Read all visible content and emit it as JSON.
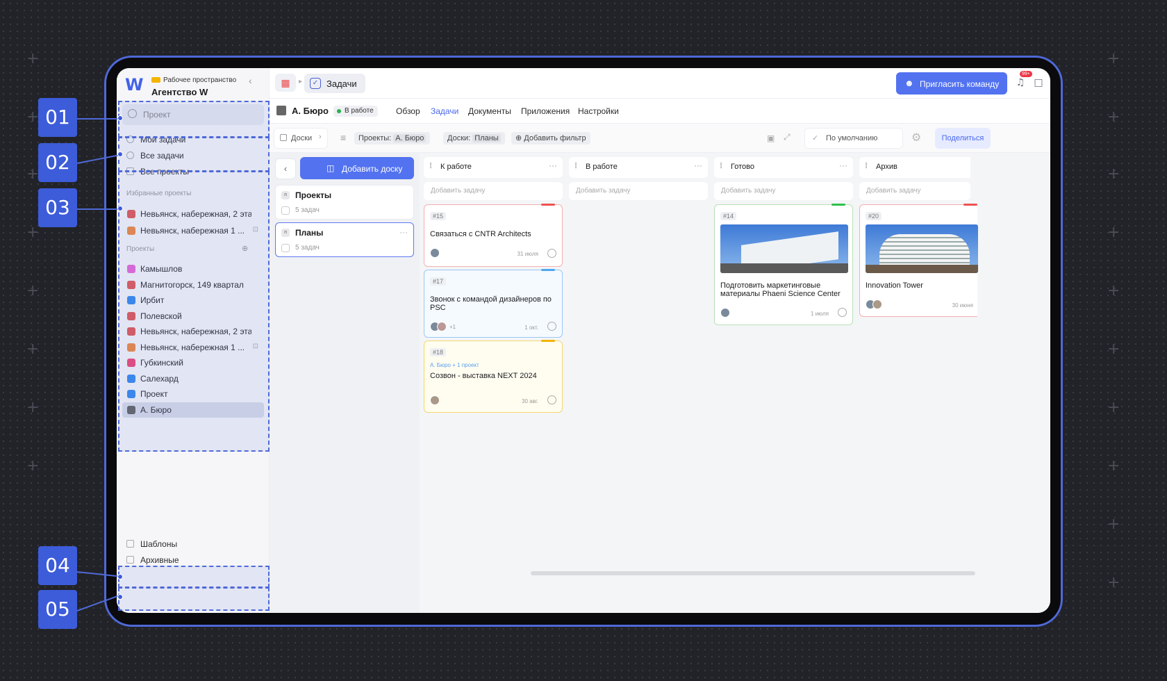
{
  "workspace": {
    "label": "Рабочее пространство",
    "name": "Агентство W"
  },
  "sidebar": {
    "search_placeholder": "Проект",
    "nav": [
      "Мои задачи",
      "Все задачи",
      "Все проекты"
    ],
    "favorites_title": "Избранные проекты",
    "favorites": [
      {
        "name": "Невьянск, набережная, 2 этап",
        "color": "#e25a5a",
        "locked": false
      },
      {
        "name": "Невьянск, набережная 1 ...",
        "color": "#f08a45",
        "locked": true
      }
    ],
    "projects_title": "Проекты",
    "projects": [
      {
        "name": "Камышлов",
        "color": "#e86ad8",
        "locked": false
      },
      {
        "name": "Магнитогорск, 149 квартал",
        "color": "#e25a5a",
        "locked": false
      },
      {
        "name": "Ирбит",
        "color": "#3a8bf0",
        "locked": false
      },
      {
        "name": "Полевской",
        "color": "#e25a5a",
        "locked": false
      },
      {
        "name": "Невьянск, набережная, 2 этап",
        "color": "#e25a5a",
        "locked": false
      },
      {
        "name": "Невьянск, набережная 1 ...",
        "color": "#f08a45",
        "locked": true
      },
      {
        "name": "Губкинский",
        "color": "#ee4a7a",
        "locked": false
      },
      {
        "name": "Салехард",
        "color": "#3a8bf0",
        "locked": false
      },
      {
        "name": "Проект",
        "color": "#3a8bf0",
        "locked": false
      },
      {
        "name": "А. Бюро",
        "color": "#666666",
        "locked": false,
        "selected": true
      }
    ],
    "footer": [
      "Шаблоны",
      "Архивные"
    ]
  },
  "topbar": {
    "tab": "Задачи",
    "invite": "Пригласить команду",
    "notif_badge": "99+",
    "icons": [
      "bell-icon",
      "folder-icon",
      "help-icon",
      "search-icon",
      "sparkle-icon",
      "apps-icon"
    ]
  },
  "project": {
    "name": "А. Бюро",
    "status": "В работе",
    "tabs": [
      "Обзор",
      "Задачи",
      "Документы",
      "Приложения",
      "Настройки"
    ],
    "active_tab": "Задачи"
  },
  "filters": {
    "boards": "Доски",
    "projects_label": "Проекты:",
    "projects_value": "А. Бюро",
    "boards_label": "Доски:",
    "boards_value": "Планы",
    "add_filter": "Добавить фильтр",
    "sort": "По умолчанию",
    "share": "Поделиться"
  },
  "boards_panel": {
    "add": "Добавить доску",
    "items": [
      {
        "name": "Проекты",
        "count": "5 задач"
      },
      {
        "name": "Планы",
        "count": "5 задач"
      }
    ]
  },
  "columns": [
    {
      "title": "К работе",
      "add": "Добавить задачу"
    },
    {
      "title": "В работе",
      "add": "Добавить задачу"
    },
    {
      "title": "Готово",
      "add": "Добавить задачу"
    },
    {
      "title": "Архив",
      "add": "Добавить задачу"
    }
  ],
  "cards": {
    "c15": {
      "num": "#15",
      "title": "Связаться с CNTR Architects",
      "date": "31 июля"
    },
    "c17": {
      "num": "#17",
      "title": "Звонок с командой дизайнеров по PSC",
      "date": "1 окт.",
      "extra": "+1"
    },
    "c18": {
      "num": "#18",
      "sub": "А. Бюро + 1 проект",
      "title": "Созвон - выставка NEXT 2024",
      "date": "30 авг."
    },
    "c14": {
      "num": "#14",
      "title": "Подготовить маркетинговые материалы Phaeni Science Center",
      "date": "1 июля"
    },
    "c20": {
      "num": "#20",
      "title": "Innovation Tower",
      "date": "30 июня"
    }
  },
  "callouts": [
    "01",
    "02",
    "03",
    "04",
    "05"
  ]
}
